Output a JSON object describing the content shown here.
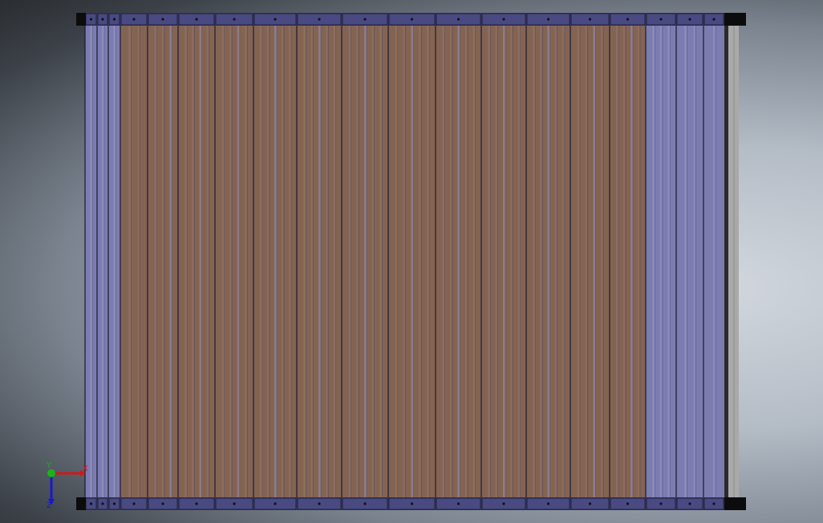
{
  "viewport": {
    "background_center": "#d3d8de",
    "background_edge": "#2a2d31"
  },
  "model": {
    "frame_color": "#3a3a6a",
    "slat_wood_color": "#836453",
    "slat_wood_light": "#9a7a6a",
    "slat_blue_color": "#7c7cb0",
    "slat_blue_light": "#9898c8",
    "end_cap_color": "#0c0c0c",
    "side_panel_color": "#a9a9a9"
  },
  "axis_triad": {
    "x_label": "X",
    "y_label": "Y",
    "z_label": "Z",
    "x_color": "#d01818",
    "y_color": "#18b418",
    "z_color": "#1818d0"
  }
}
